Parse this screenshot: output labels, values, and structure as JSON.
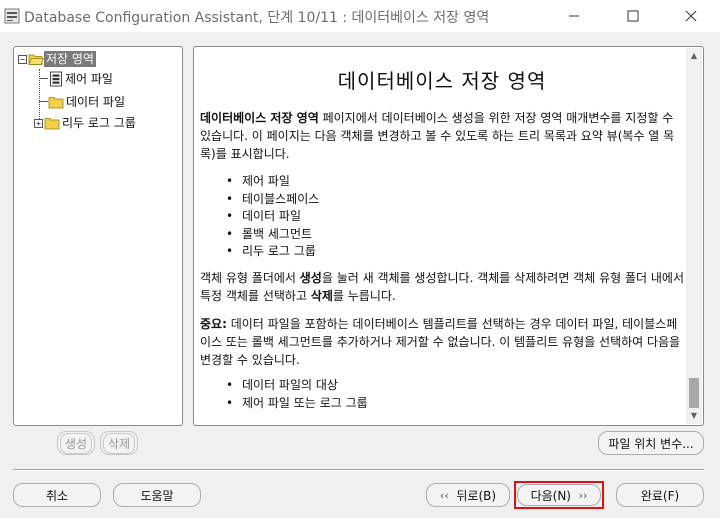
{
  "window": {
    "title": "Database Configuration Assistant, 단계 10/11 : 데이터베이스 저장 영역"
  },
  "tree": {
    "root": "저장 영역",
    "items": [
      "제어 파일",
      "데이터 파일",
      "리두 로그 그룹"
    ]
  },
  "content": {
    "title": "데이터베이스 저장 영역",
    "intro_bold": "데이터베이스 저장 영역",
    "intro_rest": " 페이지에서 데이터베이스 생성을 위한 저장 영역 매개변수를 지정할 수 있습니다. 이 페이지는 다음 객체를 변경하고 볼 수 있도록 하는 트리 목록과 요약 뷰(복수 열 목록)를 표시합니다.",
    "objects": [
      "제어 파일",
      "테이블스페이스",
      "데이터 파일",
      "롤백 세그먼트",
      "리두 로그 그룹"
    ],
    "create_pre": "객체 유형 폴더에서 ",
    "create_bold": "생성",
    "create_mid": "을 눌러 새 객체를 생성합니다. 객체를 삭제하려면 객체 유형 폴더 내에서 특정 객체를 선택하고 ",
    "delete_bold": "삭제",
    "create_post": "를 누릅니다.",
    "note_bold": "중요:",
    "note_rest": " 데이터 파일을 포함하는 데이터베이스 템플리트를 선택하는 경우 데이터 파일, 테이블스페이스 또는 롤백 세그먼트를 추가하거나 제거할 수 없습니다. 이 템플리트 유형을 선택하여 다음을 변경할 수 있습니다.",
    "changeable": [
      "데이터 파일의 대상",
      "제어 파일 또는 로그 그룹"
    ]
  },
  "buttons": {
    "create": "생성",
    "delete": "삭제",
    "file_location": "파일 위치 변수...",
    "cancel": "취소",
    "help": "도움말",
    "back": "뒤로(B)",
    "next": "다음(N)",
    "finish": "완료(F)"
  },
  "colors": {
    "highlight": "#e01010",
    "selection": "#7a7a7a"
  }
}
